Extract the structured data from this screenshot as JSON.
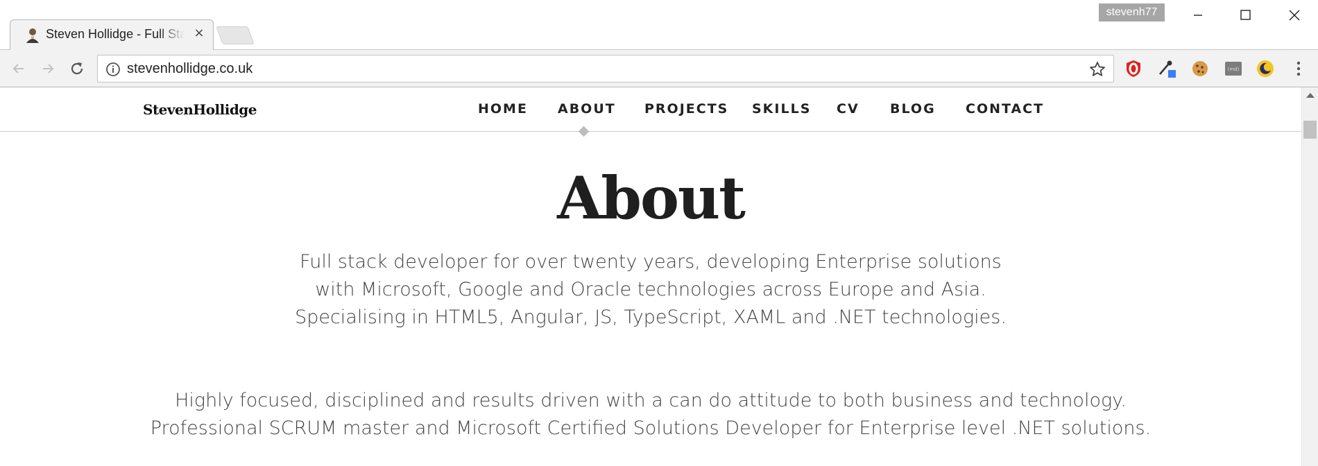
{
  "browser": {
    "tab_title": "Steven Hollidge - Full Stack Developer",
    "tab_close_label": "×",
    "profile_name": "stevenh77",
    "url": "stevenhollidge.co.uk"
  },
  "site": {
    "logo": "StevenHollidge",
    "nav": [
      {
        "label": "HOME"
      },
      {
        "label": "ABOUT",
        "active": true
      },
      {
        "label": "PROJECTS"
      },
      {
        "label": "SKILLS"
      },
      {
        "label": "CV"
      },
      {
        "label": "BLOG"
      },
      {
        "label": "CONTACT"
      }
    ]
  },
  "about": {
    "heading": "About",
    "paragraph1": [
      "Full stack developer for over twenty years, developing Enterprise solutions",
      "with Microsoft, Google and Oracle technologies across Europe and Asia.",
      "Specialising in HTML5, Angular, JS, TypeScript, XAML and .NET technologies."
    ],
    "paragraph2": [
      "Highly focused, disciplined and results driven with a can do attitude to both business and technology.",
      "Professional SCRUM master and Microsoft Certified Solutions Developer for Enterprise level .NET solutions."
    ]
  },
  "icons": {
    "back": "back-arrow-icon",
    "forward": "forward-arrow-icon",
    "reload": "reload-icon",
    "info": "info-icon",
    "star": "bookmark-star-icon",
    "extensions": [
      "opera-vpn-icon",
      "eyedropper-icon",
      "cookie-icon",
      "markdown-icon",
      "dark-mode-icon",
      "menu-dots-icon"
    ]
  },
  "colors": {
    "accent_active_marker": "#bdbdbd",
    "profile_badge": "#a6a6a6",
    "heading": "#1f1f1f"
  }
}
